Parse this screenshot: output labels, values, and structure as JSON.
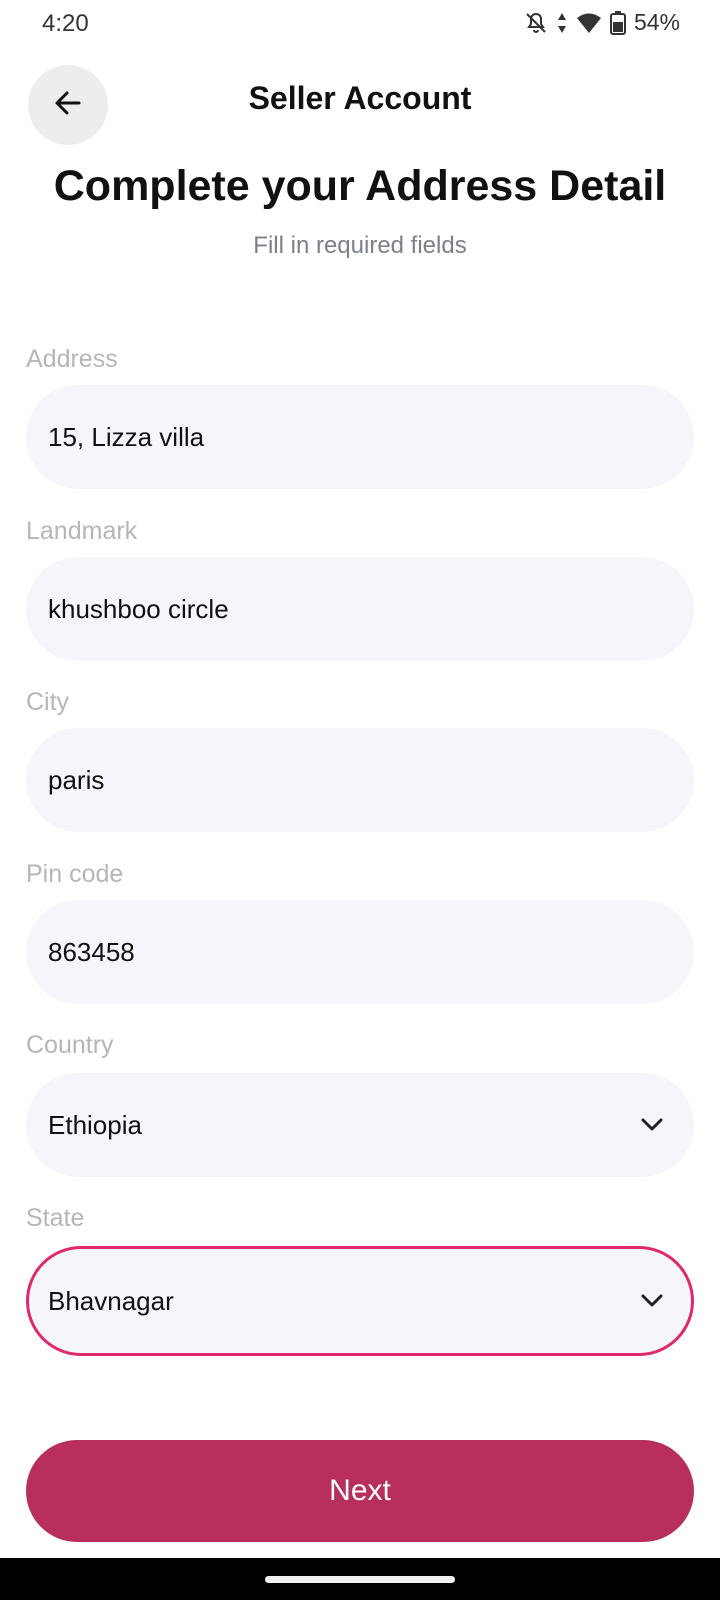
{
  "status_bar": {
    "time": "4:20",
    "battery": "54%",
    "icons": [
      "bell-off-icon",
      "data-arrows-icon",
      "wifi-icon",
      "battery-icon"
    ]
  },
  "header": {
    "title": "Seller Account",
    "back_icon": "arrow-left-icon"
  },
  "page": {
    "title": "Complete your Address Detail",
    "subtitle": "Fill in required fields"
  },
  "form": {
    "address": {
      "label": "Address",
      "value": "15, Lizza villa"
    },
    "landmark": {
      "label": "Landmark",
      "value": "khushboo circle"
    },
    "city": {
      "label": "City",
      "value": "paris"
    },
    "pincode": {
      "label": "Pin code",
      "value": "863458"
    },
    "country": {
      "label": "Country",
      "value": "Ethiopia",
      "icon": "chevron-down-icon"
    },
    "state": {
      "label": "State",
      "value": "Bhavnagar",
      "icon": "chevron-down-icon",
      "focused": true
    }
  },
  "actions": {
    "next_label": "Next"
  },
  "colors": {
    "accent": "#b82f5e",
    "focus_border": "#e0286a",
    "field_bg": "#f5f6fc",
    "label": "#b4b6bb"
  }
}
